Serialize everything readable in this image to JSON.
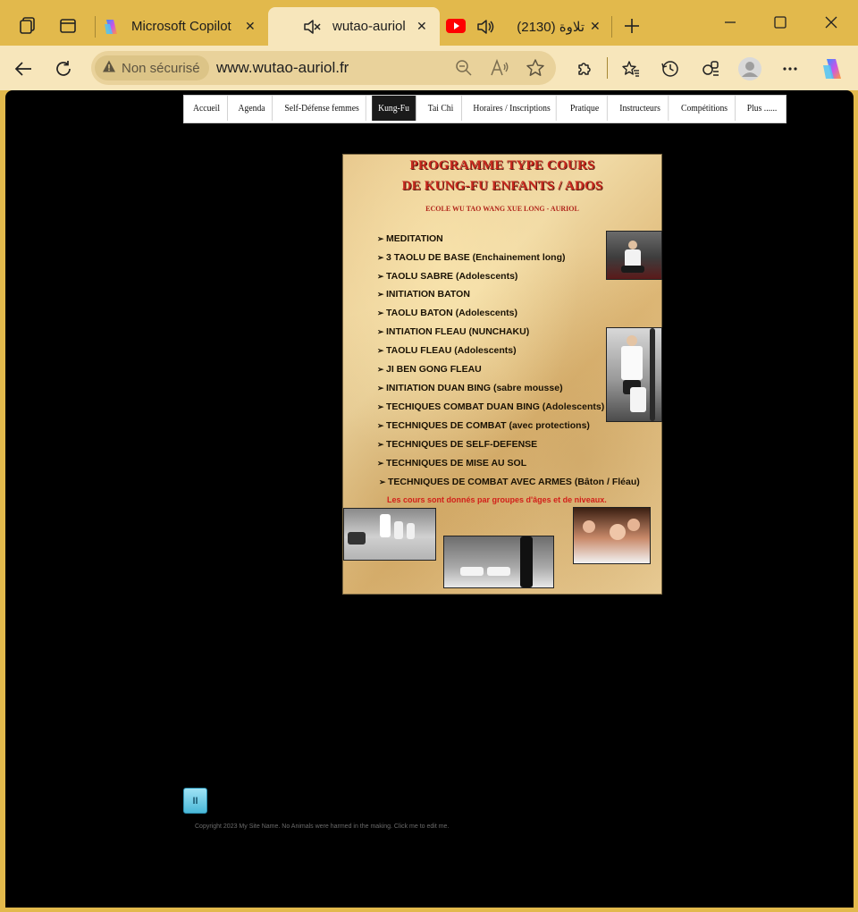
{
  "browser": {
    "tabs": [
      {
        "title": "Microsoft Copilot",
        "active": false,
        "icon": "copilot-icon"
      },
      {
        "title": "wutao-auriol",
        "active": true,
        "icon": "muted-speaker-icon"
      },
      {
        "title": "(2130) تلاوة",
        "active": false,
        "icon": "youtube-icon"
      }
    ],
    "addressbar": {
      "security_label": "Non sécurisé",
      "url": "www.wutao-auriol.fr"
    },
    "colors": {
      "frame": "#e2b94c",
      "toolbar": "#f7e6bb",
      "viewport": "#000000"
    }
  },
  "site": {
    "nav": [
      {
        "label": "Accueil",
        "active": false
      },
      {
        "label": "Agenda",
        "active": false
      },
      {
        "label": "Self-Défense femmes",
        "active": false
      },
      {
        "label": "Kung-Fu",
        "active": true
      },
      {
        "label": "Tai Chi",
        "active": false
      },
      {
        "label": "Horaires / Inscriptions",
        "active": false
      },
      {
        "label": "Pratique",
        "active": false
      },
      {
        "label": "Instructeurs",
        "active": false
      },
      {
        "label": "Compétitions",
        "active": false
      },
      {
        "label": "Plus ......",
        "active": false
      }
    ],
    "poster": {
      "title_line1": "PROGRAMME TYPE COURS",
      "title_line2": "DE KUNG-FU ENFANTS / ADOS",
      "school": "ECOLE WU TAO WANG XUE LONG - AURIOL",
      "items": [
        "MEDITATION",
        "3 TAOLU DE BASE (Enchainement long)",
        "TAOLU SABRE (Adolescents)",
        "INITIATION  BATON",
        "TAOLU BATON (Adolescents)",
        "INTIATION FLEAU (NUNCHAKU)",
        "TAOLU FLEAU (Adolescents)",
        "JI BEN GONG FLEAU",
        "INITIATION DUAN BING (sabre mousse)",
        "TECHIQUES COMBAT DUAN BING (Adolescents)",
        "TECHNIQUES DE  COMBAT  (avec protections)",
        "TECHNIQUES DE SELF-DEFENSE",
        "TECHNIQUES DE MISE AU SOL",
        "TECHNIQUES DE COMBAT AVEC ARMES (Bâton / Fléau)"
      ],
      "note": "Les cours sont donnés par groupes d'âges et de niveaux."
    },
    "pause_label": "II",
    "footer": "Copyright 2023 My Site Name. No Animals were harmed in the making. Click me to edit me."
  }
}
